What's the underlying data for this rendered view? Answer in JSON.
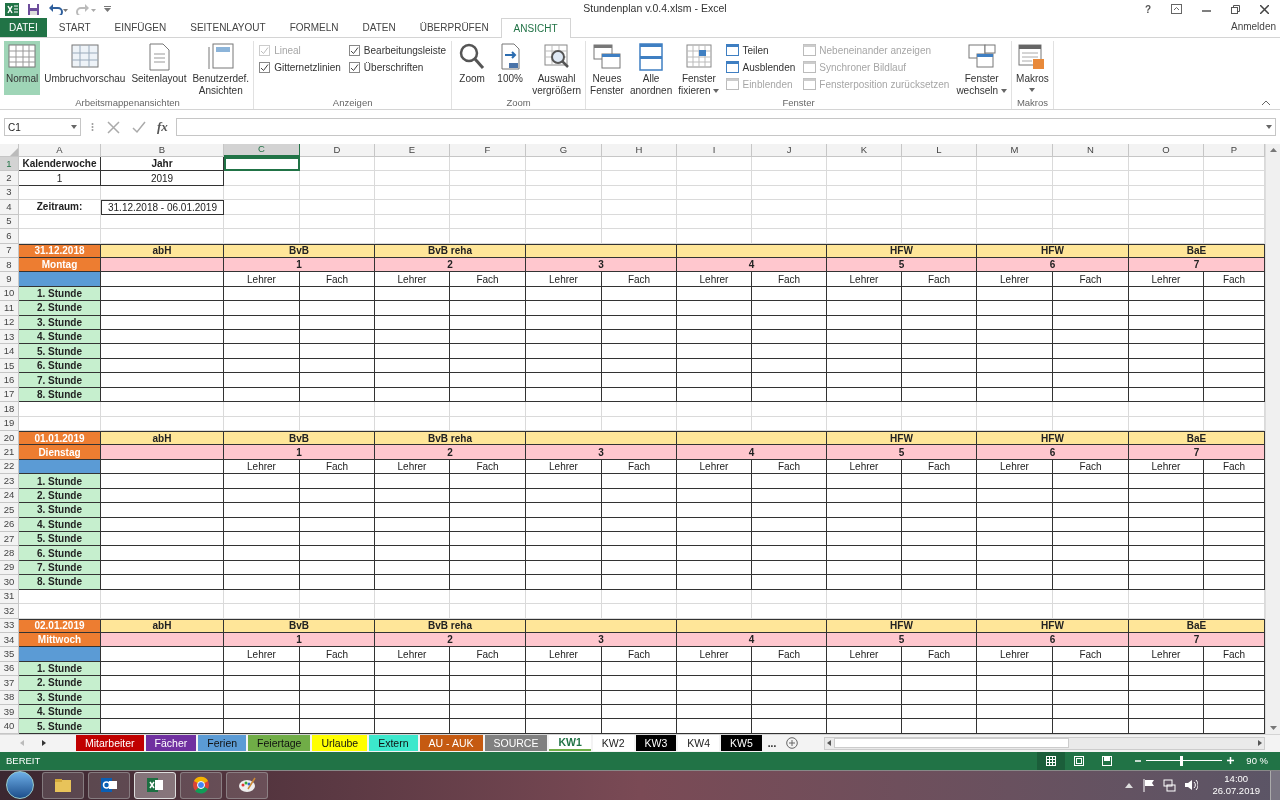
{
  "window": {
    "title": "Stundenplan v.0.4.xlsm - Excel",
    "account": "Anmelden",
    "help": "?"
  },
  "tabs": [
    {
      "label": "DATEI",
      "kind": "file",
      "selected": false
    },
    {
      "label": "START",
      "kind": "tab",
      "selected": false
    },
    {
      "label": "EINFÜGEN",
      "kind": "tab",
      "selected": false
    },
    {
      "label": "SEITENLAYOUT",
      "kind": "tab",
      "selected": false
    },
    {
      "label": "FORMELN",
      "kind": "tab",
      "selected": false
    },
    {
      "label": "DATEN",
      "kind": "tab",
      "selected": false
    },
    {
      "label": "ÜBERPRÜFEN",
      "kind": "tab",
      "selected": false
    },
    {
      "label": "ANSICHT",
      "kind": "tab",
      "selected": true
    }
  ],
  "ribbon": {
    "groups": [
      {
        "label": "Arbeitsmappenansichten",
        "items": [
          {
            "kind": "large",
            "lines": [
              "Normal"
            ],
            "selected": true
          },
          {
            "kind": "large",
            "lines": [
              "Umbruchvorschau"
            ],
            "selected": false
          },
          {
            "kind": "large",
            "lines": [
              "Seitenlayout"
            ],
            "selected": false
          },
          {
            "kind": "large",
            "lines": [
              "Benutzerdef.",
              "Ansichten"
            ],
            "selected": false
          }
        ]
      },
      {
        "label": "Anzeigen",
        "items": [
          {
            "kind": "stack",
            "items": [
              {
                "kind": "check",
                "label": "Lineal",
                "checked": true,
                "disabled": true
              },
              {
                "kind": "check",
                "label": "Gitternetzlinien",
                "checked": true,
                "disabled": false
              }
            ]
          },
          {
            "kind": "stack",
            "items": [
              {
                "kind": "check",
                "label": "Bearbeitungsleiste",
                "checked": true,
                "disabled": false
              },
              {
                "kind": "check",
                "label": "Überschriften",
                "checked": true,
                "disabled": false
              }
            ]
          }
        ]
      },
      {
        "label": "Zoom",
        "items": [
          {
            "kind": "large",
            "lines": [
              "Zoom"
            ],
            "selected": false
          },
          {
            "kind": "large",
            "lines": [
              "100%"
            ],
            "selected": false
          },
          {
            "kind": "large",
            "lines": [
              "Auswahl",
              "vergrößern"
            ],
            "selected": false
          }
        ]
      },
      {
        "label": "Fenster",
        "items": [
          {
            "kind": "large",
            "lines": [
              "Neues",
              "Fenster"
            ],
            "selected": false
          },
          {
            "kind": "large",
            "lines": [
              "Alle",
              "anordnen"
            ],
            "selected": false
          },
          {
            "kind": "large",
            "lines": [
              "Fenster",
              "fixieren"
            ],
            "selected": false,
            "dropdown": true
          },
          {
            "kind": "stack",
            "items": [
              {
                "kind": "small",
                "label": "Teilen",
                "disabled": false
              },
              {
                "kind": "small",
                "label": "Ausblenden",
                "disabled": false
              },
              {
                "kind": "small",
                "label": "Einblenden",
                "disabled": true
              }
            ]
          },
          {
            "kind": "stack",
            "items": [
              {
                "kind": "small",
                "label": "Nebeneinander anzeigen",
                "disabled": true
              },
              {
                "kind": "small",
                "label": "Synchroner Bildlauf",
                "disabled": true
              },
              {
                "kind": "small",
                "label": "Fensterposition zurücksetzen",
                "disabled": true
              }
            ]
          },
          {
            "kind": "large",
            "lines": [
              "Fenster",
              "wechseln"
            ],
            "selected": false,
            "dropdown": true
          }
        ]
      },
      {
        "label": "Makros",
        "items": [
          {
            "kind": "large",
            "lines": [
              "Makros"
            ],
            "selected": false,
            "dropdown": true
          }
        ]
      }
    ]
  },
  "formula_bar": {
    "name_box": "C1",
    "function_label": "fx"
  },
  "sheet": {
    "columns": [
      {
        "letter": "A",
        "selected": false
      },
      {
        "letter": "B",
        "selected": false
      },
      {
        "letter": "C",
        "selected": true
      },
      {
        "letter": "D",
        "selected": false
      },
      {
        "letter": "E",
        "selected": false
      },
      {
        "letter": "F",
        "selected": false
      },
      {
        "letter": "G",
        "selected": false
      },
      {
        "letter": "H",
        "selected": false
      },
      {
        "letter": "I",
        "selected": false
      },
      {
        "letter": "J",
        "selected": false
      },
      {
        "letter": "K",
        "selected": false
      },
      {
        "letter": "L",
        "selected": false
      },
      {
        "letter": "M",
        "selected": false
      },
      {
        "letter": "N",
        "selected": false
      },
      {
        "letter": "O",
        "selected": false
      },
      {
        "letter": "P",
        "selected": false
      }
    ],
    "rows": [
      {
        "number": "1",
        "selected": true,
        "kind": "title",
        "cells": [
          "Kalenderwoche",
          "Jahr"
        ]
      },
      {
        "number": "2",
        "selected": false,
        "kind": "values",
        "cells": [
          "1",
          "2019"
        ]
      },
      {
        "number": "3",
        "selected": false,
        "kind": "blank"
      },
      {
        "number": "4",
        "selected": false,
        "kind": "period",
        "label": "Zeitraum:",
        "value": "31.12.2018 - 06.01.2019"
      },
      {
        "number": "5",
        "selected": false,
        "kind": "blank"
      },
      {
        "number": "6",
        "selected": false,
        "kind": "blank"
      },
      {
        "number": "7",
        "selected": false,
        "kind": "day",
        "date": "31.12.2018",
        "groups": [
          {
            "kind": "label",
            "label": "abH"
          },
          {
            "kind": "label",
            "label": "BvB"
          },
          {
            "kind": "label",
            "label": "BvB reha"
          },
          {
            "kind": "empty"
          },
          {
            "kind": "empty"
          },
          {
            "kind": "label",
            "label": "HFW"
          },
          {
            "kind": "label",
            "label": "HFW"
          },
          {
            "kind": "label",
            "label": "BaE"
          }
        ]
      },
      {
        "number": "8",
        "selected": false,
        "kind": "weekday",
        "weekday": "Montag",
        "numbers": [
          "1",
          "2",
          "3",
          "4",
          "5",
          "6",
          "7"
        ]
      },
      {
        "number": "9",
        "selected": false,
        "kind": "subhead",
        "labels": [
          "Lehrer",
          "Fach",
          "Lehrer",
          "Fach",
          "Lehrer",
          "Fach",
          "Lehrer",
          "Fach",
          "Lehrer",
          "Fach",
          "Lehrer",
          "Fach",
          "Lehrer",
          "Fach"
        ]
      },
      {
        "number": "10",
        "selected": false,
        "kind": "lesson",
        "label": "1. Stunde"
      },
      {
        "number": "11",
        "selected": false,
        "kind": "lesson",
        "label": "2. Stunde"
      },
      {
        "number": "12",
        "selected": false,
        "kind": "lesson",
        "label": "3. Stunde"
      },
      {
        "number": "13",
        "selected": false,
        "kind": "lesson",
        "label": "4. Stunde"
      },
      {
        "number": "14",
        "selected": false,
        "kind": "lesson",
        "label": "5. Stunde"
      },
      {
        "number": "15",
        "selected": false,
        "kind": "lesson",
        "label": "6. Stunde"
      },
      {
        "number": "16",
        "selected": false,
        "kind": "lesson",
        "label": "7. Stunde"
      },
      {
        "number": "17",
        "selected": false,
        "kind": "lesson",
        "label": "8. Stunde"
      },
      {
        "number": "18",
        "selected": false,
        "kind": "blank"
      },
      {
        "number": "19",
        "selected": false,
        "kind": "blank"
      },
      {
        "number": "20",
        "selected": false,
        "kind": "day",
        "date": "01.01.2019",
        "groups": [
          {
            "kind": "label",
            "label": "abH"
          },
          {
            "kind": "label",
            "label": "BvB"
          },
          {
            "kind": "label",
            "label": "BvB reha"
          },
          {
            "kind": "empty"
          },
          {
            "kind": "empty"
          },
          {
            "kind": "label",
            "label": "HFW"
          },
          {
            "kind": "label",
            "label": "HFW"
          },
          {
            "kind": "label",
            "label": "BaE"
          }
        ]
      },
      {
        "number": "21",
        "selected": false,
        "kind": "weekday",
        "weekday": "Dienstag",
        "numbers": [
          "1",
          "2",
          "3",
          "4",
          "5",
          "6",
          "7"
        ]
      },
      {
        "number": "22",
        "selected": false,
        "kind": "subhead",
        "labels": [
          "Lehrer",
          "Fach",
          "Lehrer",
          "Fach",
          "Lehrer",
          "Fach",
          "Lehrer",
          "Fach",
          "Lehrer",
          "Fach",
          "Lehrer",
          "Fach",
          "Lehrer",
          "Fach"
        ]
      },
      {
        "number": "23",
        "selected": false,
        "kind": "lesson",
        "label": "1. Stunde"
      },
      {
        "number": "24",
        "selected": false,
        "kind": "lesson",
        "label": "2. Stunde"
      },
      {
        "number": "25",
        "selected": false,
        "kind": "lesson",
        "label": "3. Stunde"
      },
      {
        "number": "26",
        "selected": false,
        "kind": "lesson",
        "label": "4. Stunde"
      },
      {
        "number": "27",
        "selected": false,
        "kind": "lesson",
        "label": "5. Stunde"
      },
      {
        "number": "28",
        "selected": false,
        "kind": "lesson",
        "label": "6. Stunde"
      },
      {
        "number": "29",
        "selected": false,
        "kind": "lesson",
        "label": "7. Stunde"
      },
      {
        "number": "30",
        "selected": false,
        "kind": "lesson",
        "label": "8. Stunde"
      },
      {
        "number": "31",
        "selected": false,
        "kind": "blank"
      },
      {
        "number": "32",
        "selected": false,
        "kind": "blank"
      },
      {
        "number": "33",
        "selected": false,
        "kind": "day",
        "date": "02.01.2019",
        "groups": [
          {
            "kind": "label",
            "label": "abH"
          },
          {
            "kind": "label",
            "label": "BvB"
          },
          {
            "kind": "label",
            "label": "BvB reha"
          },
          {
            "kind": "empty"
          },
          {
            "kind": "empty"
          },
          {
            "kind": "label",
            "label": "HFW"
          },
          {
            "kind": "label",
            "label": "HFW"
          },
          {
            "kind": "label",
            "label": "BaE"
          }
        ]
      },
      {
        "number": "34",
        "selected": false,
        "kind": "weekday",
        "weekday": "Mittwoch",
        "numbers": [
          "1",
          "2",
          "3",
          "4",
          "5",
          "6",
          "7"
        ]
      },
      {
        "number": "35",
        "selected": false,
        "kind": "subhead",
        "labels": [
          "Lehrer",
          "Fach",
          "Lehrer",
          "Fach",
          "Lehrer",
          "Fach",
          "Lehrer",
          "Fach",
          "Lehrer",
          "Fach",
          "Lehrer",
          "Fach",
          "Lehrer",
          "Fach"
        ]
      },
      {
        "number": "36",
        "selected": false,
        "kind": "lesson",
        "label": "1. Stunde"
      },
      {
        "number": "37",
        "selected": false,
        "kind": "lesson",
        "label": "2. Stunde"
      },
      {
        "number": "38",
        "selected": false,
        "kind": "lesson",
        "label": "3. Stunde"
      },
      {
        "number": "39",
        "selected": false,
        "kind": "lesson",
        "label": "4. Stunde"
      },
      {
        "number": "40",
        "selected": false,
        "kind": "lesson",
        "label": "5. Stunde"
      }
    ]
  },
  "sheet_tabs": [
    {
      "label": "Mitarbeiter",
      "color": "#c00000",
      "selected": false
    },
    {
      "label": "Fächer",
      "color": "#7030a0",
      "selected": false
    },
    {
      "label": "Ferien",
      "color": "#5b9bd5",
      "selected": false
    },
    {
      "label": "Feiertage",
      "color": "#70ad47",
      "selected": false
    },
    {
      "label": "Urlaube",
      "color": "#ffff00",
      "selected": false
    },
    {
      "label": "Extern",
      "color": "#3ce8cc",
      "selected": false
    },
    {
      "label": "AU - AUK",
      "color": "#c55a11",
      "selected": false
    },
    {
      "label": "SOURCE",
      "color": "#808080",
      "selected": false
    },
    {
      "label": "KW1",
      "color": "#70ad47",
      "selected": true
    },
    {
      "label": "KW2",
      "selected": false
    },
    {
      "label": "KW3",
      "color": "#000000",
      "selected": false
    },
    {
      "label": "KW4",
      "selected": false
    },
    {
      "label": "KW5",
      "color": "#000000",
      "selected": false
    }
  ],
  "more_tabs": "...",
  "status_bar": {
    "status": "BEREIT",
    "views": [
      {
        "selected": true
      },
      {
        "selected": false
      },
      {
        "selected": false
      }
    ],
    "zoom": {
      "level": 0.45,
      "reading": "90 %"
    }
  },
  "taskbar": {
    "apps": [
      {
        "selected": false
      },
      {
        "selected": false
      },
      {
        "selected": true
      },
      {
        "selected": false
      },
      {
        "selected": false
      }
    ],
    "time": "14:00",
    "date": "26.07.2019"
  }
}
